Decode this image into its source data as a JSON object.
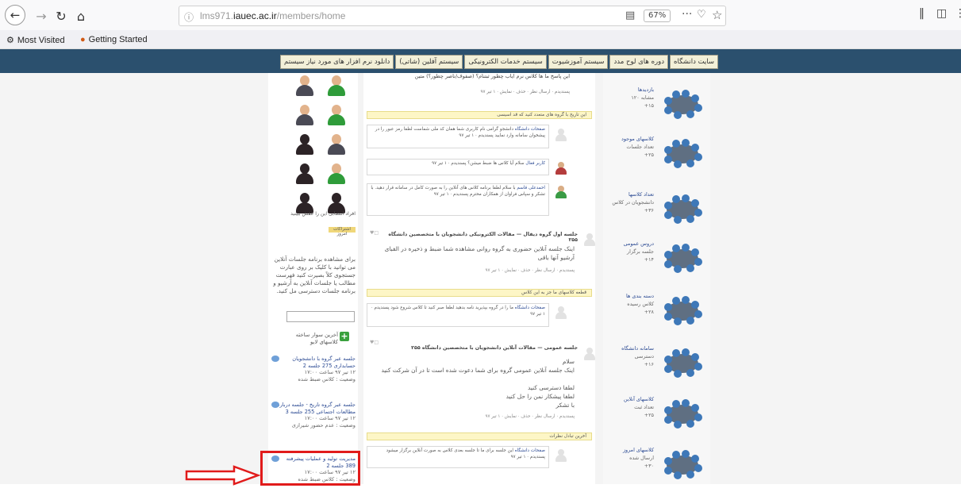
{
  "browser": {
    "url_prefix": "lms971.",
    "url_domain": "iauec.ac.ir",
    "url_path": "/members/home",
    "zoom": "67%",
    "bookmarks": [
      {
        "label": "Most Visited",
        "icon": "gear-icon"
      },
      {
        "label": "Getting Started",
        "icon": "firefox-icon"
      }
    ]
  },
  "site": {
    "nav": [
      "سایت دانشگاه",
      "دوره های لوح مدد",
      "سیستم آموزشیوت",
      "سیستم خدمات الکترونیکی",
      "سیستم آفلین (شاتی)",
      "دانلود نرم افزار های مورد نیاز سیستم"
    ]
  },
  "left": {
    "members_caption": "افراد انتصابی این را عقش ببینید",
    "share_label": "اشتراکات امروز",
    "notice": "برای مشاهده برنامه جلسات آنلاین می توانید با کلیک بر روی عبارت جستجوی کلاً بصیرت کنید فهرست مطالب یا جلسات آنلاین به آرشیو و برنامه جلسات دسترسی مل کنید.",
    "add_label": "آخرین سوار ساخته کلاسهای لایو",
    "sessions": [
      {
        "title": "جلسه عبر گروه با دانشجویان حسابداری 275 جلسه 2",
        "meta": "۱۲ تیر ۹۷ ساعت ۱۷:۰۰",
        "meta2": "وضعیت : کلاس ضبط شده"
      },
      {
        "title": "جلسه عبر گروه تاریخ - جلسه درباره مطالعات اجتماعی 255 جلسه 3",
        "meta": "۱۲ تیر ۹۷ ساعت ۱۷:۰۰",
        "meta2": "وضعیت : عدم حضور شیرازی"
      },
      {
        "title": "مدیریت تولید و عملیات پیشرفته 389 جلسه 2",
        "meta": "۱۲ تیر ۹۷ ساعت ۱۷:۰۰",
        "meta2": "وضعیت : کلاس ضبط شده"
      }
    ]
  },
  "middle": {
    "top_question": "این پاسخ ما ها کلاس نرم ایاب چطور ثبتنام؟ (صفوف/ناصر چطور؟) متین",
    "top_meta": "پسندیدم · ارسال نظر · حذف · نمایش · ۱ تیر ۹۷",
    "bar1": "این تاریخ با گروه های متعدد کنید که قد اسیسی",
    "comments": [
      {
        "name": "صفحات دانشگاه",
        "text": "دانشجو گرامی نام کاربری شما همان کد ملی شماست لطفا رمز عبور را در پیشخوان سامانه وارد نمایید",
        "meta": "پسندیدم · ۱ تیر ۹۷"
      },
      {
        "name": "کاربر فعال",
        "text": "سلام آیا کلاس ها ضبط میشن؟",
        "meta": "پسندیدم · ۱ تیر ۹۷"
      },
      {
        "name": "احمدعلی قاسم",
        "text": "با سلام لطفا برنامه کلاس های آنلاین را به صورت کامل در سامانه قرار دهید. با تشکر و سپاس فراوان از همکاران محترم",
        "meta": "پسندیدم · ۱ تیر ۹۷"
      }
    ],
    "post2_header": "جلسه اول گروه دیفال — مقالات الکترونیکی دانشجویان با متخصصین دانشگاه ۲۵۵",
    "post2_body": "اینک جلسه آنلاین حضوری به گروه روانی مشاهده شما ضبط و ذخیره در الفبای آرشیو آنها باقی",
    "post2_meta": "پسندیدم · ارسال نظر · حذف · نمایش · ۱ تیر ۹۷",
    "bar2": "قطعه کلاسهای ما جز به این کلاس",
    "comment4": {
      "name": "صفحات دانشگاه",
      "text": "ما را در گروه بپذیرید نامه بدهید لطفا صبر کنید تا کلاس شروع شود",
      "meta": "پسندیدم · ۱ تیر ۹۷"
    },
    "post3_header": "جلسه عمومی — مقالات آنلاین دانشجویان با متخصصین دانشگاه ۲۵۵",
    "post3_lines": [
      "سلام",
      "اینک جلسه آنلاین عمومی گروه برای شما دعوت شده است تا در آن شرکت کنید",
      "لطفا دسترسی کنید",
      "لطفا پیشکار نمن را حل کنید",
      "با تشکر"
    ],
    "post3_meta": "پسندیدم · ارسال نظر · حذف · نمایش · ۱ تیر ۹۷",
    "bar3": "آخرین تبادل نظرات",
    "comment5": {
      "name": "صفحات دانشگاه",
      "text": "این جلسه برای ما تا جلسه بعدی کلاس به صورت آنلاین برگزار میشود",
      "meta": "پسندیدم · ۱ تیر ۹۷"
    }
  },
  "right": {
    "groups": [
      {
        "name": "بازدیدها",
        "sub": "مشابه ۱۲۰",
        "count": "۱۵+"
      },
      {
        "name": "کلاسهای موجود",
        "sub": "تعداد جلسات",
        "count": "۲۵+"
      },
      {
        "name": "تعداد کلاسها",
        "sub": "دانشجویان در کلاس",
        "count": "۳۶+"
      },
      {
        "name": "دروس عمومی",
        "sub": "جلسه برگزار",
        "count": "۱۴+"
      },
      {
        "name": "دسته بندی ها",
        "sub": "کلاس رسیده",
        "count": "۲۸+"
      },
      {
        "name": "سامانه دانشگاه",
        "sub": "دسترسی",
        "count": "۱۶+"
      },
      {
        "name": "کلاسهای آنلاین",
        "sub": "تعداد ثبت",
        "count": "۲۵+"
      },
      {
        "name": "کلاسهای امروز",
        "sub": "ارسال شده",
        "count": "۳۰+"
      }
    ]
  },
  "colors": {
    "band": "#2b506e",
    "highlight": "#e11b1b",
    "link": "#2b4a93"
  }
}
